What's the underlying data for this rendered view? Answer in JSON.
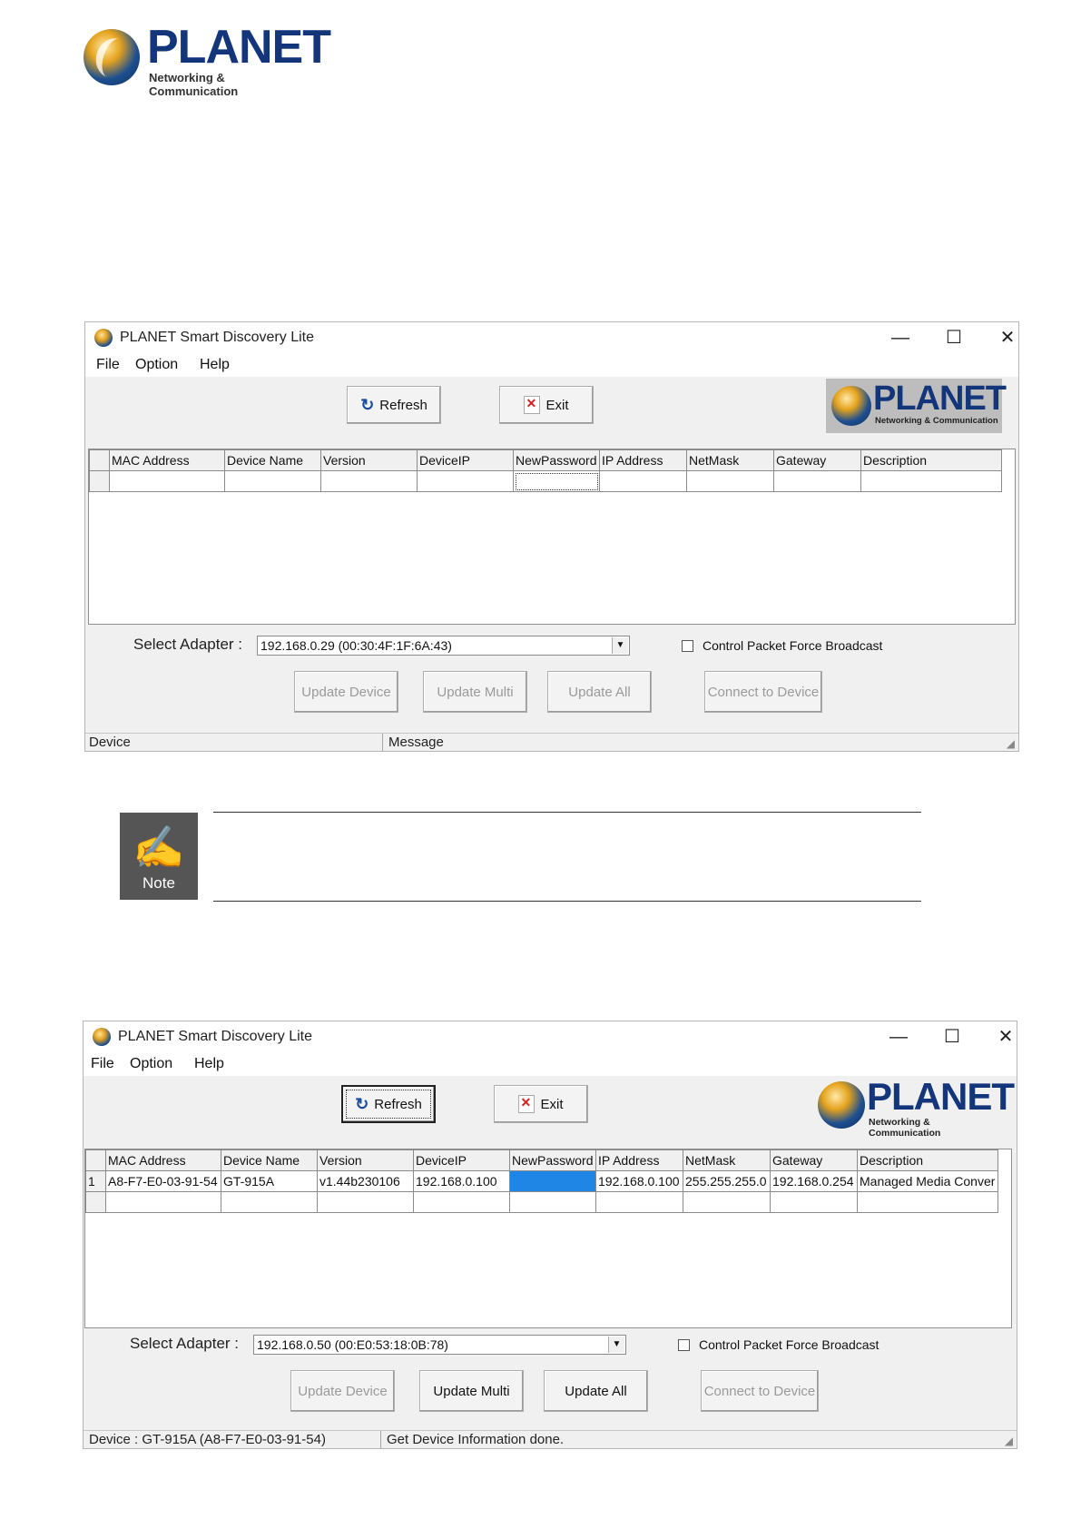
{
  "brand": {
    "name": "PLANET",
    "tagline": "Networking & Communication"
  },
  "note": {
    "label": "Note"
  },
  "windows": [
    {
      "title": "PLANET Smart Discovery Lite",
      "controls": {
        "minimize": "—",
        "maximize": "☐",
        "close": "✕"
      },
      "menu": [
        "File",
        "Option",
        "Help"
      ],
      "toolbar": {
        "refresh": "Refresh",
        "exit": "Exit"
      },
      "logo": {
        "name": "PLANET",
        "tagline": "Networking & Communication"
      },
      "columns": [
        "MAC Address",
        "Device Name",
        "Version",
        "DeviceIP",
        "NewPassword",
        "IP Address",
        "NetMask",
        "Gateway",
        "Description"
      ],
      "rows": [
        {
          "num": "",
          "cells": [
            "",
            "",
            "",
            "",
            "",
            "",
            "",
            "",
            ""
          ]
        }
      ],
      "adapter": {
        "label": "Select Adapter :",
        "value": "192.168.0.29 (00:30:4F:1F:6A:43)"
      },
      "broadcast": {
        "label": "Control Packet Force Broadcast",
        "checked": false
      },
      "actions": {
        "update_device": "Update Device",
        "update_multi": "Update Multi",
        "update_all": "Update All",
        "connect": "Connect to Device"
      },
      "status": {
        "device": "Device",
        "message": "Message"
      }
    },
    {
      "title": "PLANET Smart Discovery Lite",
      "controls": {
        "minimize": "—",
        "maximize": "☐",
        "close": "✕"
      },
      "menu": [
        "File",
        "Option",
        "Help"
      ],
      "toolbar": {
        "refresh": "Refresh",
        "exit": "Exit"
      },
      "logo": {
        "name": "PLANET",
        "tagline": "Networking & Communication"
      },
      "columns": [
        "MAC Address",
        "Device Name",
        "Version",
        "DeviceIP",
        "NewPassword",
        "IP Address",
        "NetMask",
        "Gateway",
        "Description"
      ],
      "rows": [
        {
          "num": "1",
          "cells": [
            "A8-F7-E0-03-91-54",
            "GT-915A",
            "v1.44b230106",
            "192.168.0.100",
            "",
            "192.168.0.100",
            "255.255.255.0",
            "192.168.0.254",
            "Managed Media Conver"
          ]
        },
        {
          "num": "",
          "cells": [
            "",
            "",
            "",
            "",
            "",
            "",
            "",
            "",
            ""
          ]
        }
      ],
      "adapter": {
        "label": "Select Adapter :",
        "value": "192.168.0.50 (00:E0:53:18:0B:78)"
      },
      "broadcast": {
        "label": "Control Packet Force Broadcast",
        "checked": false
      },
      "actions": {
        "update_device": "Update Device",
        "update_multi": "Update Multi",
        "update_all": "Update All",
        "connect": "Connect to Device"
      },
      "status": {
        "device": "Device :  GT-915A (A8-F7-E0-03-91-54)",
        "message": "Get Device Information done."
      }
    }
  ]
}
